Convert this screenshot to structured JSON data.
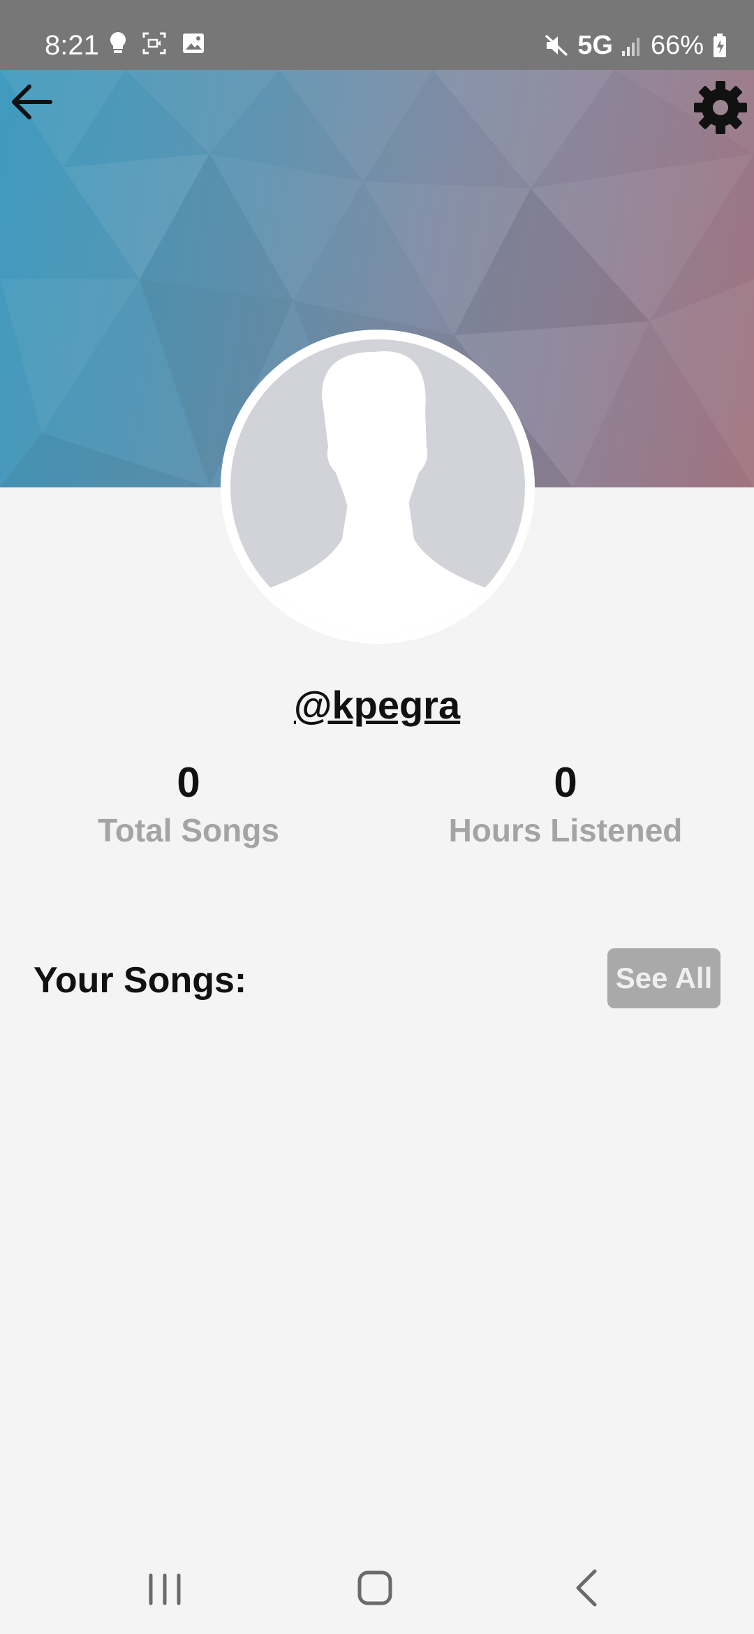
{
  "status_bar": {
    "time": "8:21",
    "network": "5G",
    "battery": "66%",
    "icons": [
      "lightbulb-icon",
      "screen-record-icon",
      "gallery-icon",
      "mute-icon",
      "signal-icon",
      "battery-icon"
    ]
  },
  "header": {
    "back_icon": "arrow-left-icon",
    "settings_icon": "gear-icon"
  },
  "profile": {
    "username": "@kpegra",
    "avatar_icon": "default-user-silhouette-icon"
  },
  "stats": [
    {
      "value": "0",
      "label": "Total Songs"
    },
    {
      "value": "0",
      "label": "Hours Listened"
    }
  ],
  "songs_section": {
    "title": "Your Songs:",
    "see_all_label": "See All",
    "songs": []
  },
  "nav_bar": {
    "items": [
      "recent-apps-icon",
      "home-icon",
      "back-icon"
    ]
  },
  "colors": {
    "banner_gradient": [
      "#3f9bbf",
      "#7e8ca4",
      "#a0727e"
    ],
    "page_background": "#f4f4f4",
    "status_bar": "#777777",
    "label_gray": "#a4a4a4",
    "button_gray": "#a9a9a9"
  }
}
